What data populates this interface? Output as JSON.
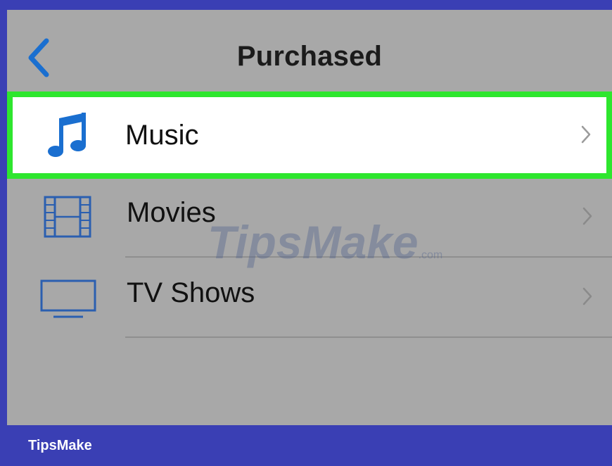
{
  "nav": {
    "title": "Purchased",
    "back_icon": "chevron-left-icon"
  },
  "list": {
    "items": [
      {
        "label": "Music",
        "icon": "music-note-icon",
        "selected": true
      },
      {
        "label": "Movies",
        "icon": "film-strip-icon",
        "selected": false
      },
      {
        "label": "TV Shows",
        "icon": "tv-icon",
        "selected": false
      }
    ]
  },
  "watermark": {
    "brand": "TipsMake",
    "suffix": ".com"
  },
  "footer": {
    "brand": "TipsMake"
  },
  "colors": {
    "accent": "#1a6fd0",
    "highlight": "#2ee62e",
    "frame_border": "#3a3fb4",
    "background": "#a8a8a8"
  }
}
